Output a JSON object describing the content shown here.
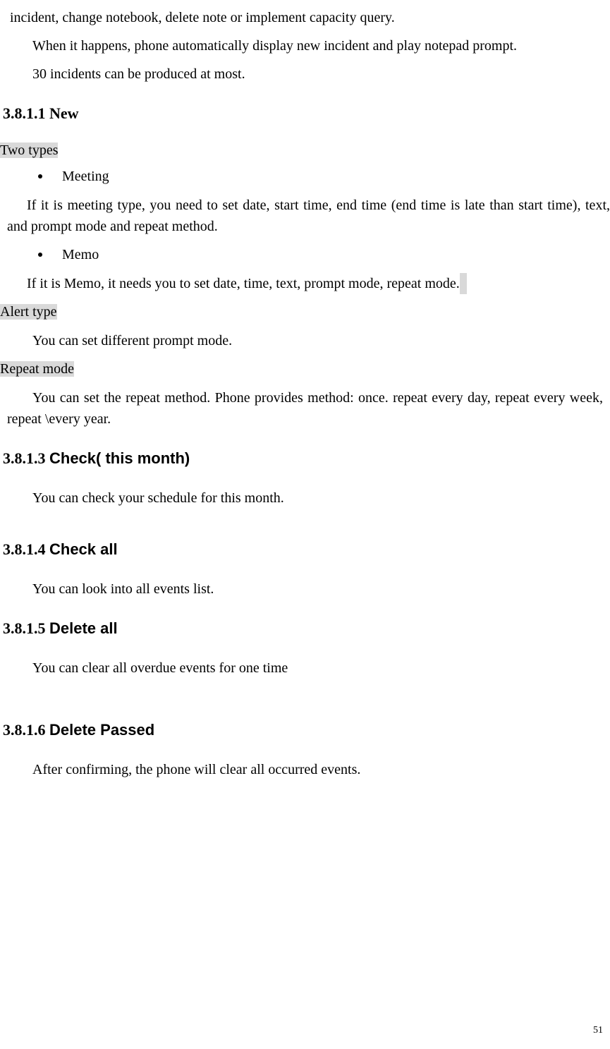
{
  "top": {
    "line1": "incident, change notebook, delete note or implement capacity query.",
    "line2": "When it happens, phone automatically display new incident and play notepad prompt.",
    "line3": "30 incidents can be produced at most."
  },
  "sec_3_8_1_1": {
    "number": "3.8.1.1",
    "title": "New",
    "two_types_label": "Two types",
    "bullet_meeting": "Meeting",
    "meeting_desc": "If it is meeting type, you need to set date, start time, end time (end time is late than start time), text, and prompt mode and repeat method.",
    "bullet_memo": "Memo",
    "memo_desc": "If it is Memo, it needs you to set date, time, text, prompt mode, repeat mode.",
    "alert_type_label": "Alert type",
    "alert_type_desc": "You can set different prompt mode.",
    "repeat_mode_label": "Repeat mode",
    "repeat_mode_desc": "You can set the repeat method. Phone provides method: once. repeat every day, repeat every week, repeat \\every year."
  },
  "sec_3_8_1_3": {
    "number": "3.8.1.3",
    "title": "Check( this month)",
    "desc": "You can check your schedule for this month."
  },
  "sec_3_8_1_4": {
    "number": "3.8.1.4",
    "title": "Check all",
    "desc": "You can look into all events list."
  },
  "sec_3_8_1_5": {
    "number": "3.8.1.5",
    "title": "Delete all",
    "desc": "You can clear all overdue events for one time"
  },
  "sec_3_8_1_6": {
    "number": "3.8.1.6",
    "title": "Delete Passed",
    "desc": "After confirming, the phone will clear all occurred events."
  },
  "page_number": "51"
}
